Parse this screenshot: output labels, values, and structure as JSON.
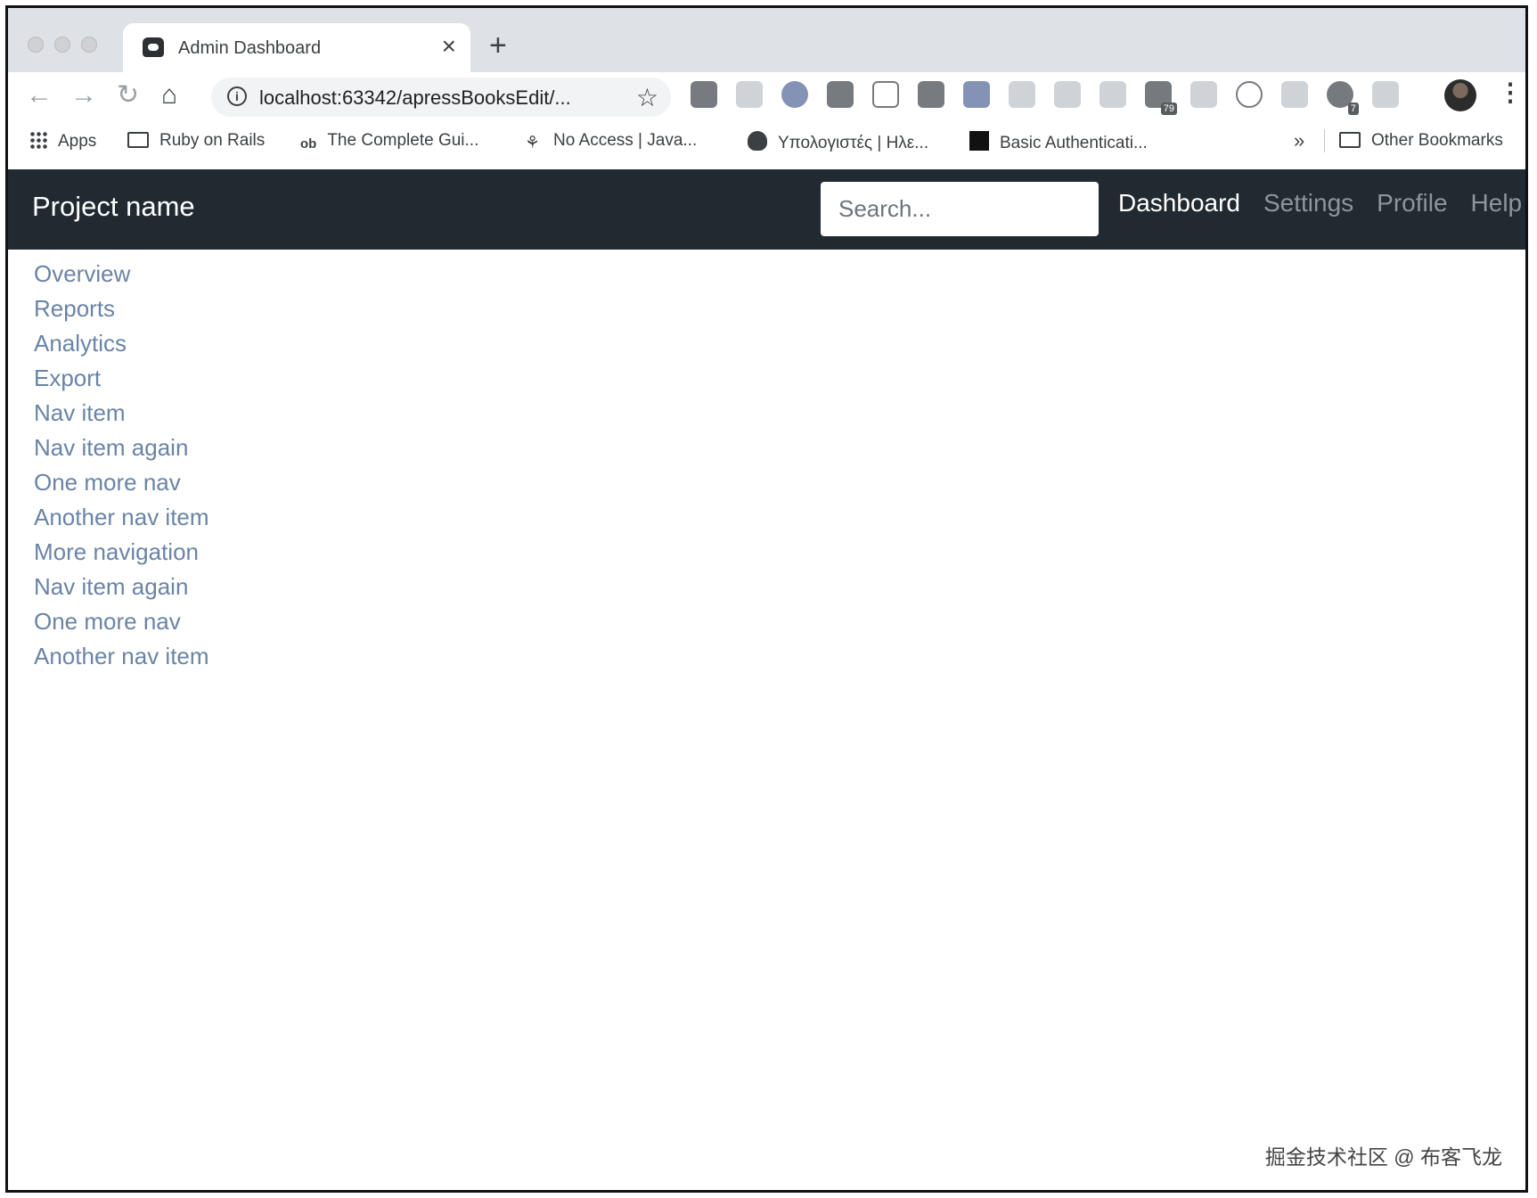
{
  "browser": {
    "tab_title": "Admin Dashboard",
    "close_tab": "×",
    "new_tab": "+",
    "url": "localhost:63342/apressBooksEdit/...",
    "back": "←",
    "forward": "→",
    "reload": "↻",
    "home": "⌂",
    "star": "☆",
    "menu": "⋮",
    "extension_badges": [
      "79",
      "7"
    ],
    "bookmarks": [
      "Apps",
      "Ruby on Rails",
      "The Complete Gui...",
      "No Access | Java...",
      "Υπολογιστές | Ηλε...",
      "Basic Authenticati..."
    ],
    "bookmark_ob_mark": "ob",
    "bookmarks_more": "»",
    "other_bookmarks": "Other Bookmarks"
  },
  "navbar": {
    "brand": "Project name",
    "search_placeholder": "Search...",
    "links": [
      "Dashboard",
      "Settings",
      "Profile",
      "Help"
    ],
    "active": "Dashboard"
  },
  "sidebar": {
    "items": [
      "Overview",
      "Reports",
      "Analytics",
      "Export",
      "Nav item",
      "Nav item again",
      "One more nav",
      "Another nav item",
      "More navigation",
      "Nav item again",
      "One more nav",
      "Another nav item"
    ]
  },
  "watermark": "掘金技术社区 @ 布客飞龙",
  "colors": {
    "navbar_bg": "#212a31",
    "sidebar_link": "#6a84a6",
    "nav_active": "#ffffff",
    "nav_inactive": "#8e959c"
  }
}
